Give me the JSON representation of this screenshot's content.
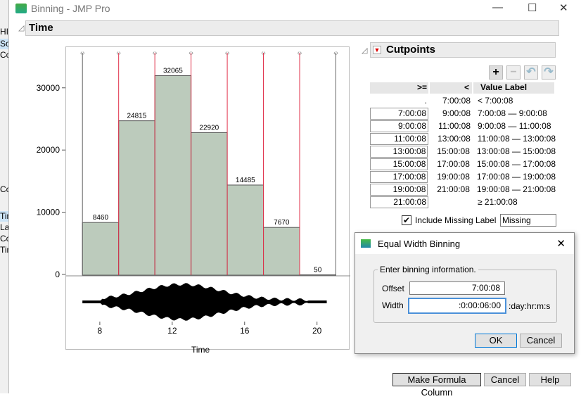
{
  "window": {
    "title": "Binning - JMP Pro",
    "minimize": "—",
    "maximize": "☐",
    "close": "✕"
  },
  "background_app": {
    "items": [
      "HIST",
      "Sou",
      "Co",
      "Colu",
      "Tim",
      "Lab",
      "Cou",
      "Tim"
    ]
  },
  "section_title": "Time",
  "chart_data": {
    "type": "bar",
    "xlabel": "Time",
    "ylabel": "",
    "x_ticks": [
      8,
      12,
      16,
      20
    ],
    "y_ticks": [
      0,
      10000,
      20000,
      30000
    ],
    "ylim": [
      0,
      36650
    ],
    "xlim": [
      6.1,
      21.8
    ],
    "bins": [
      {
        "from": 7.0022,
        "to": 9.0022,
        "value": 8460
      },
      {
        "from": 9.0022,
        "to": 11.0022,
        "value": 24815
      },
      {
        "from": 11.0022,
        "to": 13.0022,
        "value": 32065
      },
      {
        "from": 13.0022,
        "to": 15.0022,
        "value": 22920
      },
      {
        "from": 15.0022,
        "to": 17.0022,
        "value": 14485
      },
      {
        "from": 17.0022,
        "to": 19.0022,
        "value": 7670
      },
      {
        "from": 19.0022,
        "to": 21.0022,
        "value": 50
      }
    ],
    "bar_color": "#bccbbc",
    "cut_color": "#e0304a"
  },
  "cutpoints": {
    "title": "Cutpoints",
    "headers": [
      ">=",
      "<",
      "Value Label"
    ],
    "rows": [
      [
        ".",
        "7:00:08",
        "< 7:00:08"
      ],
      [
        "7:00:08",
        "9:00:08",
        "7:00:08 — 9:00:08"
      ],
      [
        "9:00:08",
        "11:00:08",
        "9:00:08 — 11:00:08"
      ],
      [
        "11:00:08",
        "13:00:08",
        "11:00:08 — 13:00:08"
      ],
      [
        "13:00:08",
        "15:00:08",
        "13:00:08 — 15:00:08"
      ],
      [
        "15:00:08",
        "17:00:08",
        "15:00:08 — 17:00:08"
      ],
      [
        "17:00:08",
        "19:00:08",
        "17:00:08 — 19:00:08"
      ],
      [
        "19:00:08",
        "21:00:08",
        "19:00:08 — 21:00:08"
      ],
      [
        "21:00:08",
        "",
        "≥ 21:00:08"
      ]
    ],
    "include_missing_label": "Include Missing Label",
    "include_missing_checked": true,
    "missing_value": "Missing"
  },
  "toolbar": {
    "add": "+",
    "remove": "−",
    "undo": "↶",
    "redo": "↷"
  },
  "dialog": {
    "title": "Equal Width Binning",
    "group": "Enter binning information.",
    "offset_label": "Offset",
    "offset_value": "7:00:08",
    "width_label": "Width",
    "width_value": ":0:00:06:00",
    "width_unit": ":day:hr:m:s",
    "ok": "OK",
    "cancel": "Cancel",
    "close": "✕"
  },
  "buttons": {
    "make_formula": "Make Formula Column",
    "cancel": "Cancel",
    "help": "Help"
  }
}
